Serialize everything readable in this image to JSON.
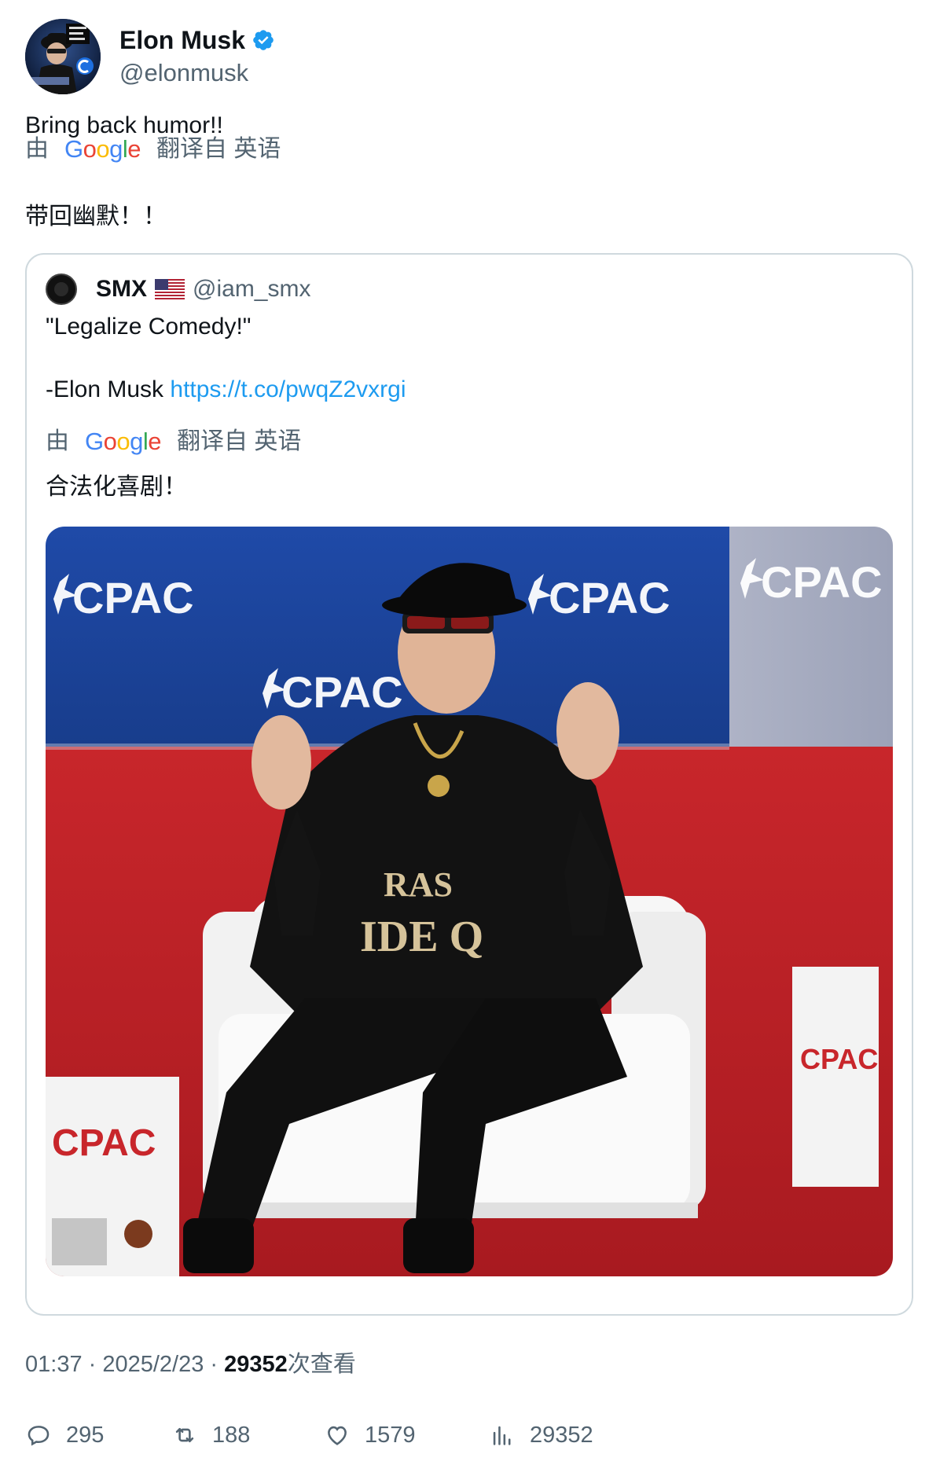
{
  "author": {
    "display_name": "Elon Musk",
    "handle": "@elonmusk",
    "verified": true,
    "avatar_icon": "avatar-image"
  },
  "tweet": {
    "text": "Bring back humor!!",
    "translation": {
      "prefix": "由",
      "provider": "Google",
      "suffix": "翻译自 英语",
      "text": "带回幽默！！"
    }
  },
  "quote": {
    "display_name": "SMX",
    "flag": "🇺🇸",
    "handle": "@iam_smx",
    "line1": "\"Legalize Comedy!\"",
    "line2_prefix": "-Elon Musk ",
    "line2_link": "https://t.co/pwqZ2vxrgi",
    "translation": {
      "prefix": "由",
      "provider": "Google",
      "suffix": "翻译自 英语",
      "text": "合法化喜剧！"
    },
    "image": {
      "description_icon": "photo-image",
      "banner_text": "CPAC",
      "shirt_text_1": "RAS",
      "shirt_text_2": "IDE Q"
    }
  },
  "meta": {
    "time": "01:37",
    "sep1": " · ",
    "date": "2025/2/23",
    "sep2": " · ",
    "views_count": "29352",
    "views_label": "次查看"
  },
  "actions": {
    "replies": "295",
    "retweets": "188",
    "likes": "1579",
    "views": "29352"
  },
  "colors": {
    "accent": "#1d9bf0",
    "secondary_text": "#536471",
    "border": "#cfd9de"
  }
}
